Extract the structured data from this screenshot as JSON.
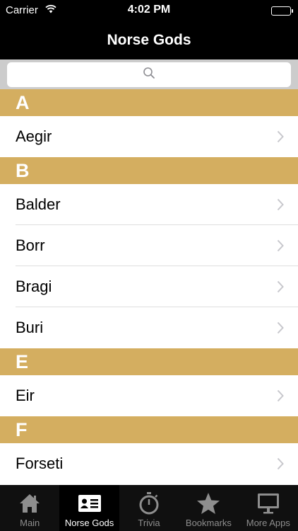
{
  "status": {
    "carrier": "Carrier",
    "time": "4:02 PM"
  },
  "nav": {
    "title": "Norse Gods"
  },
  "search": {
    "placeholder": ""
  },
  "sections": [
    {
      "letter": "A",
      "items": [
        "Aegir"
      ]
    },
    {
      "letter": "B",
      "items": [
        "Balder",
        "Borr",
        "Bragi",
        "Buri"
      ]
    },
    {
      "letter": "E",
      "items": [
        "Eir"
      ]
    },
    {
      "letter": "F",
      "items": [
        "Forseti"
      ]
    }
  ],
  "tabs": [
    {
      "label": "Main",
      "icon": "house-icon"
    },
    {
      "label": "Norse Gods",
      "icon": "id-card-icon",
      "active": true
    },
    {
      "label": "Trivia",
      "icon": "stopwatch-icon"
    },
    {
      "label": "Bookmarks",
      "icon": "star-icon"
    },
    {
      "label": "More Apps",
      "icon": "monitor-icon"
    }
  ],
  "colors": {
    "section_header": "#d4ae60",
    "bars": "#000000",
    "tab_inactive": "#8e8e8e"
  }
}
